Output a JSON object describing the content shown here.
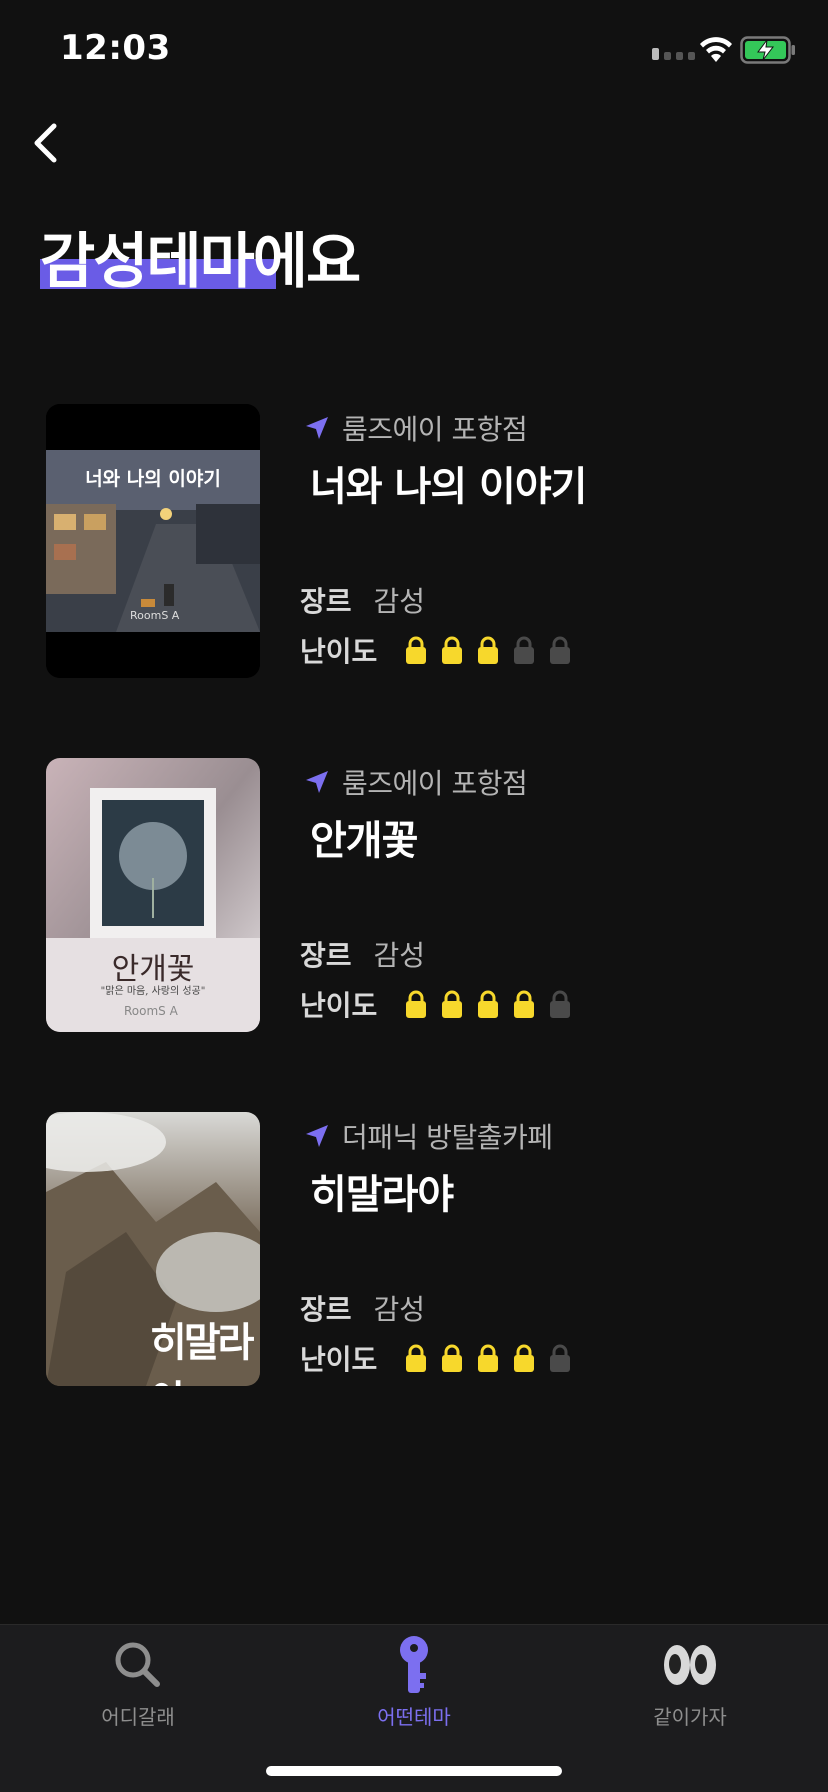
{
  "status_bar": {
    "time": "12:03"
  },
  "header": {
    "title": "감성테마에요"
  },
  "themes": [
    {
      "location": "룸즈에이 포항점",
      "name": "너와 나의 이야기",
      "genre_label": "장르",
      "genre": "감성",
      "difficulty_label": "난이도",
      "difficulty": 3,
      "difficulty_max": 5,
      "poster_title": "너와 나의 이야기",
      "poster_brand": "RoomS A"
    },
    {
      "location": "룸즈에이 포항점",
      "name": "안개꽃",
      "genre_label": "장르",
      "genre": "감성",
      "difficulty_label": "난이도",
      "difficulty": 4,
      "difficulty_max": 5,
      "poster_title": "안개꽃",
      "poster_subtitle": "\"맑은 마음, 사랑의 성공\"",
      "poster_brand": "RoomS A"
    },
    {
      "location": "더패닉 방탈출카페",
      "name": "히말라야",
      "genre_label": "장르",
      "genre": "감성",
      "difficulty_label": "난이도",
      "difficulty": 4,
      "difficulty_max": 5,
      "poster_title": "히말라야"
    }
  ],
  "tab_bar": {
    "tabs": [
      {
        "label": "어디갈래",
        "icon": "search-icon",
        "active": false
      },
      {
        "label": "어떤테마",
        "icon": "key-icon",
        "active": true
      },
      {
        "label": "같이가자",
        "icon": "eyes-icon",
        "active": false
      }
    ]
  },
  "colors": {
    "accent": "#7c6ff0",
    "lock_on": "#f7d82c",
    "lock_off": "#4a4a4a",
    "background": "#111111"
  }
}
